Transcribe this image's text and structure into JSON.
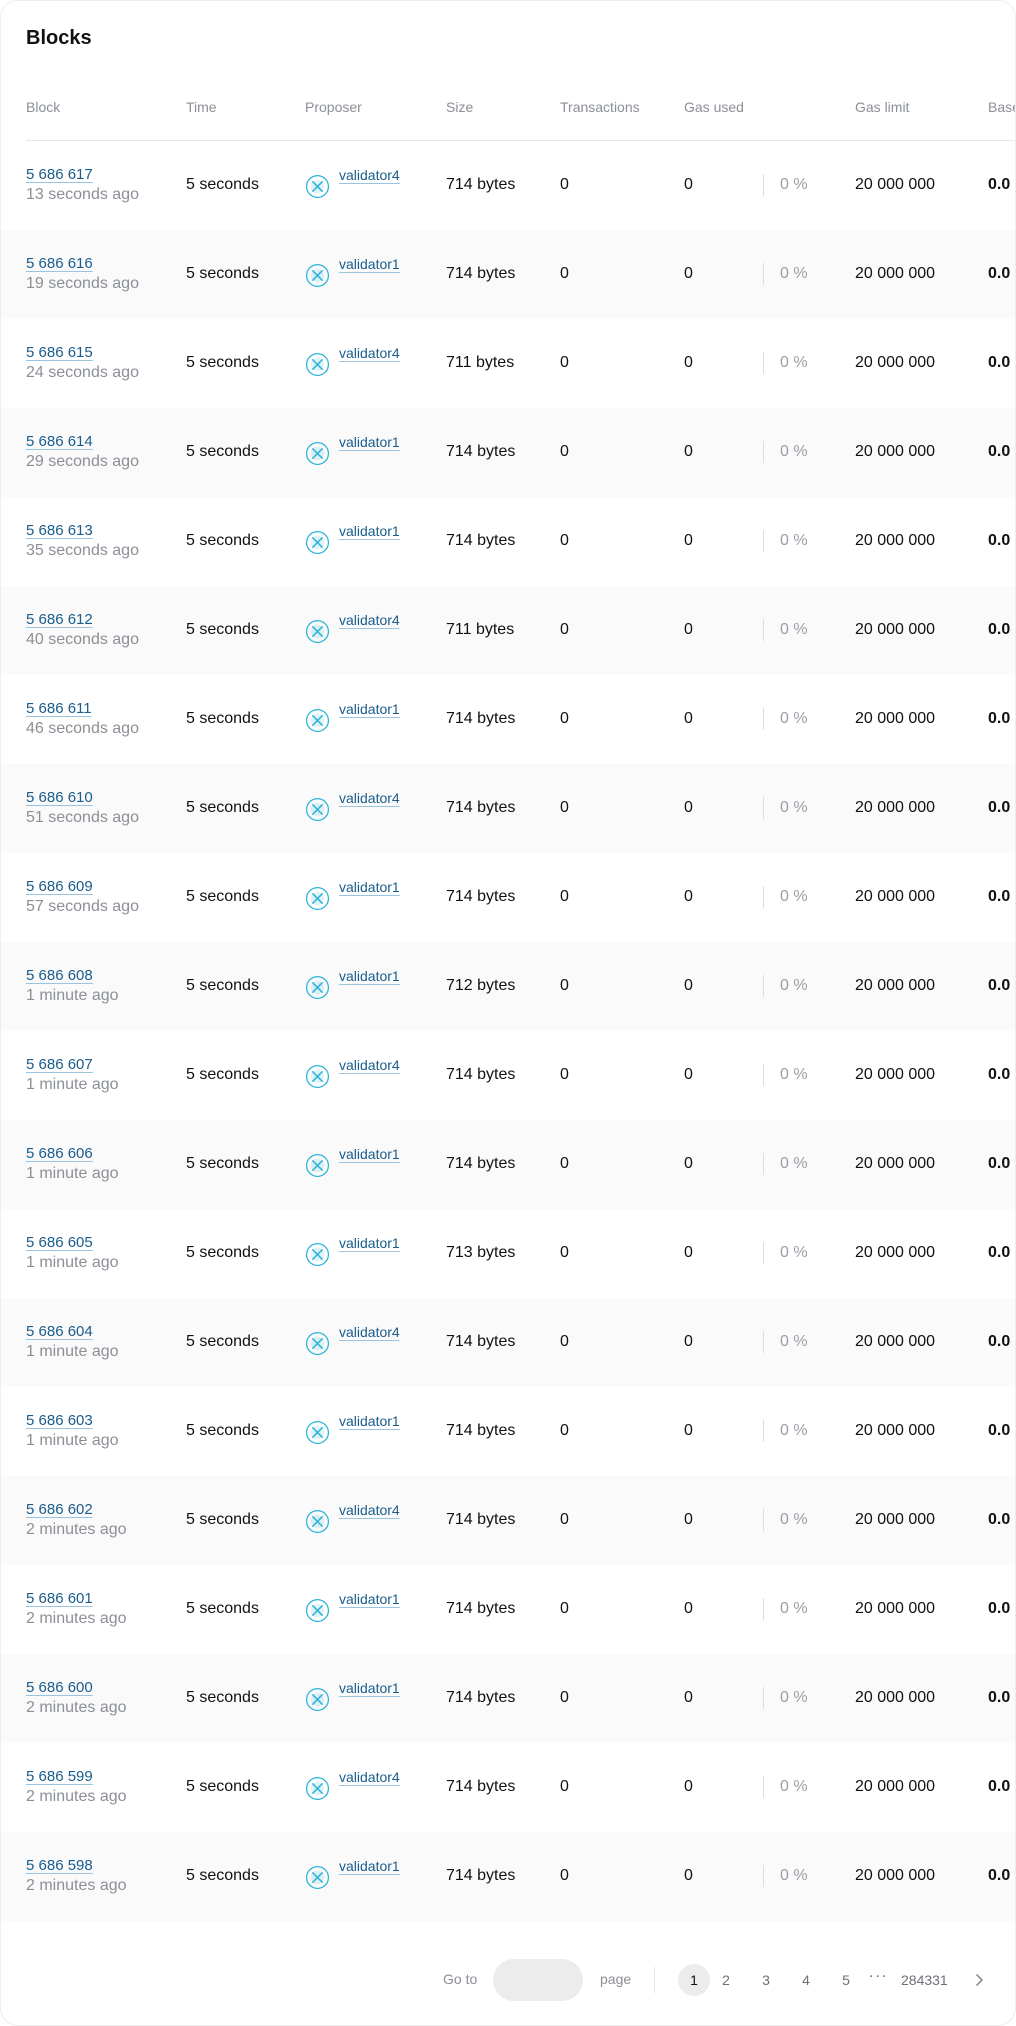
{
  "page": {
    "title": "Blocks"
  },
  "table": {
    "headers": {
      "block": "Block",
      "time": "Time",
      "proposer": "Proposer",
      "size": "Size",
      "transactions": "Transactions",
      "gas_used": "Gas used",
      "gas_limit": "Gas limit",
      "base_fee": "Base"
    },
    "rows": [
      {
        "block": "5 686 617",
        "ago": "13 seconds ago",
        "time": "5 seconds",
        "proposer": "validator4",
        "size": "714 bytes",
        "txs": "0",
        "gas_used": "0",
        "gas_pct": "0 %",
        "gas_limit": "20 000 000",
        "base": "0.0"
      },
      {
        "block": "5 686 616",
        "ago": "19 seconds ago",
        "time": "5 seconds",
        "proposer": "validator1",
        "size": "714 bytes",
        "txs": "0",
        "gas_used": "0",
        "gas_pct": "0 %",
        "gas_limit": "20 000 000",
        "base": "0.0"
      },
      {
        "block": "5 686 615",
        "ago": "24 seconds ago",
        "time": "5 seconds",
        "proposer": "validator4",
        "size": "711 bytes",
        "txs": "0",
        "gas_used": "0",
        "gas_pct": "0 %",
        "gas_limit": "20 000 000",
        "base": "0.0"
      },
      {
        "block": "5 686 614",
        "ago": "29 seconds ago",
        "time": "5 seconds",
        "proposer": "validator1",
        "size": "714 bytes",
        "txs": "0",
        "gas_used": "0",
        "gas_pct": "0 %",
        "gas_limit": "20 000 000",
        "base": "0.0"
      },
      {
        "block": "5 686 613",
        "ago": "35 seconds ago",
        "time": "5 seconds",
        "proposer": "validator1",
        "size": "714 bytes",
        "txs": "0",
        "gas_used": "0",
        "gas_pct": "0 %",
        "gas_limit": "20 000 000",
        "base": "0.0"
      },
      {
        "block": "5 686 612",
        "ago": "40 seconds ago",
        "time": "5 seconds",
        "proposer": "validator4",
        "size": "711 bytes",
        "txs": "0",
        "gas_used": "0",
        "gas_pct": "0 %",
        "gas_limit": "20 000 000",
        "base": "0.0"
      },
      {
        "block": "5 686 611",
        "ago": "46 seconds ago",
        "time": "5 seconds",
        "proposer": "validator1",
        "size": "714 bytes",
        "txs": "0",
        "gas_used": "0",
        "gas_pct": "0 %",
        "gas_limit": "20 000 000",
        "base": "0.0"
      },
      {
        "block": "5 686 610",
        "ago": "51 seconds ago",
        "time": "5 seconds",
        "proposer": "validator4",
        "size": "714 bytes",
        "txs": "0",
        "gas_used": "0",
        "gas_pct": "0 %",
        "gas_limit": "20 000 000",
        "base": "0.0"
      },
      {
        "block": "5 686 609",
        "ago": "57 seconds ago",
        "time": "5 seconds",
        "proposer": "validator1",
        "size": "714 bytes",
        "txs": "0",
        "gas_used": "0",
        "gas_pct": "0 %",
        "gas_limit": "20 000 000",
        "base": "0.0"
      },
      {
        "block": "5 686 608",
        "ago": "1 minute ago",
        "time": "5 seconds",
        "proposer": "validator1",
        "size": "712 bytes",
        "txs": "0",
        "gas_used": "0",
        "gas_pct": "0 %",
        "gas_limit": "20 000 000",
        "base": "0.0"
      },
      {
        "block": "5 686 607",
        "ago": "1 minute ago",
        "time": "5 seconds",
        "proposer": "validator4",
        "size": "714 bytes",
        "txs": "0",
        "gas_used": "0",
        "gas_pct": "0 %",
        "gas_limit": "20 000 000",
        "base": "0.0"
      },
      {
        "block": "5 686 606",
        "ago": "1 minute ago",
        "time": "5 seconds",
        "proposer": "validator1",
        "size": "714 bytes",
        "txs": "0",
        "gas_used": "0",
        "gas_pct": "0 %",
        "gas_limit": "20 000 000",
        "base": "0.0"
      },
      {
        "block": "5 686 605",
        "ago": "1 minute ago",
        "time": "5 seconds",
        "proposer": "validator1",
        "size": "713 bytes",
        "txs": "0",
        "gas_used": "0",
        "gas_pct": "0 %",
        "gas_limit": "20 000 000",
        "base": "0.0"
      },
      {
        "block": "5 686 604",
        "ago": "1 minute ago",
        "time": "5 seconds",
        "proposer": "validator4",
        "size": "714 bytes",
        "txs": "0",
        "gas_used": "0",
        "gas_pct": "0 %",
        "gas_limit": "20 000 000",
        "base": "0.0"
      },
      {
        "block": "5 686 603",
        "ago": "1 minute ago",
        "time": "5 seconds",
        "proposer": "validator1",
        "size": "714 bytes",
        "txs": "0",
        "gas_used": "0",
        "gas_pct": "0 %",
        "gas_limit": "20 000 000",
        "base": "0.0"
      },
      {
        "block": "5 686 602",
        "ago": "2 minutes ago",
        "time": "5 seconds",
        "proposer": "validator4",
        "size": "714 bytes",
        "txs": "0",
        "gas_used": "0",
        "gas_pct": "0 %",
        "gas_limit": "20 000 000",
        "base": "0.0"
      },
      {
        "block": "5 686 601",
        "ago": "2 minutes ago",
        "time": "5 seconds",
        "proposer": "validator1",
        "size": "714 bytes",
        "txs": "0",
        "gas_used": "0",
        "gas_pct": "0 %",
        "gas_limit": "20 000 000",
        "base": "0.0"
      },
      {
        "block": "5 686 600",
        "ago": "2 minutes ago",
        "time": "5 seconds",
        "proposer": "validator1",
        "size": "714 bytes",
        "txs": "0",
        "gas_used": "0",
        "gas_pct": "0 %",
        "gas_limit": "20 000 000",
        "base": "0.0"
      },
      {
        "block": "5 686 599",
        "ago": "2 minutes ago",
        "time": "5 seconds",
        "proposer": "validator4",
        "size": "714 bytes",
        "txs": "0",
        "gas_used": "0",
        "gas_pct": "0 %",
        "gas_limit": "20 000 000",
        "base": "0.0"
      },
      {
        "block": "5 686 598",
        "ago": "2 minutes ago",
        "time": "5 seconds",
        "proposer": "validator1",
        "size": "714 bytes",
        "txs": "0",
        "gas_used": "0",
        "gas_pct": "0 %",
        "gas_limit": "20 000 000",
        "base": "0.0"
      }
    ]
  },
  "pagination": {
    "goto_label": "Go to",
    "goto_value": "",
    "page_label": "page",
    "pages": [
      "1",
      "2",
      "3",
      "4",
      "5"
    ],
    "current": "1",
    "ellipsis": "...",
    "last": "284331",
    "next_icon": "chevron-right-icon"
  },
  "colors": {
    "link": "#1a5c8b",
    "muted": "#8b8f96",
    "proposer_icon": "#2bb3d9",
    "row_alt": "#fafafa"
  }
}
